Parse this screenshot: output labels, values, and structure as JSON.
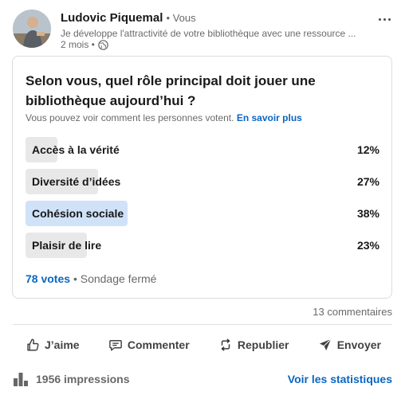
{
  "post": {
    "author_name": "Ludovic Piquemal",
    "author_relation": "• Vous",
    "headline": "Je développe l'attractivité de votre bibliothèque avec une ressource ...",
    "age": "2 mois •",
    "visibility_icon": "globe-icon"
  },
  "poll": {
    "question": "Selon vous, quel rôle principal doit jouer une bibliothèque aujourd’hui ?",
    "visibility_text": "Vous pouvez voir comment les personnes votent.",
    "learn_more": "En savoir plus",
    "options": [
      {
        "label": "Accès à la vérité",
        "percent": "12%",
        "value": 12,
        "selected": false
      },
      {
        "label": "Diversité d’idées",
        "percent": "27%",
        "value": 27,
        "selected": false
      },
      {
        "label": "Cohésion sociale",
        "percent": "38%",
        "value": 38,
        "selected": true
      },
      {
        "label": "Plaisir de lire",
        "percent": "23%",
        "value": 23,
        "selected": false
      }
    ],
    "votes": "78 votes",
    "status": "• Sondage fermé"
  },
  "social": {
    "comments": "13 commentaires"
  },
  "actions": {
    "like": "J’aime",
    "comment": "Commenter",
    "repost": "Republier",
    "send": "Envoyer"
  },
  "analytics": {
    "impressions": "1956 impressions",
    "stats_link": "Voir les statistiques"
  },
  "colors": {
    "accent": "#0a66c2",
    "bar": "#e8e8e8",
    "bar_selected": "#d0e2f7"
  }
}
